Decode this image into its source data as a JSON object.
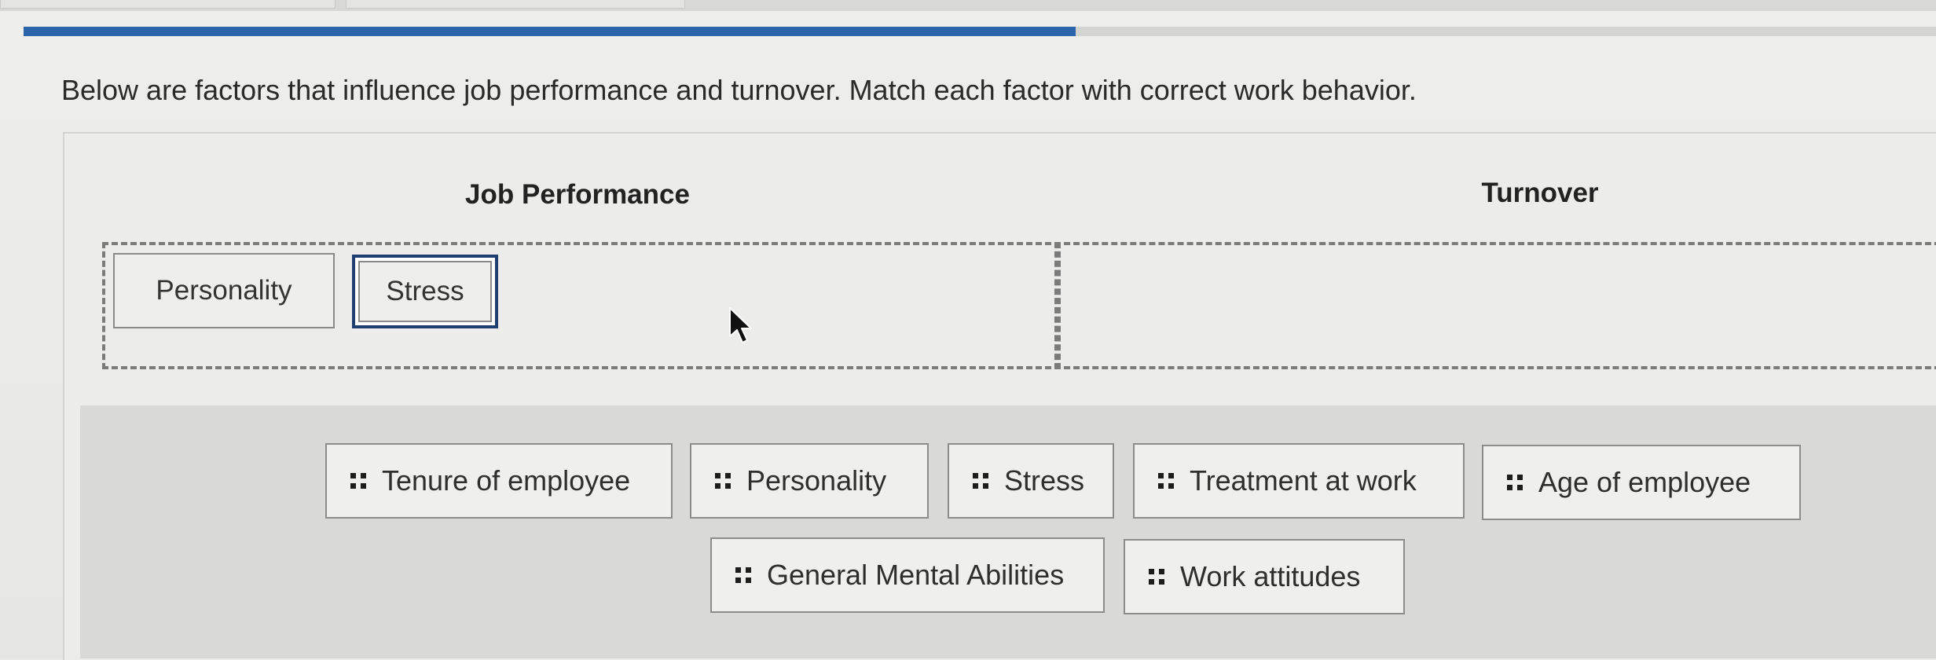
{
  "question": {
    "text": "Below are factors that influence job performance and turnover. Match each factor with correct work behavior."
  },
  "progress": {
    "fraction": 0.55,
    "color": "#2c64a8"
  },
  "columns": [
    {
      "header": "Job Performance",
      "items": [
        {
          "label": "Personality",
          "selected": false
        },
        {
          "label": "Stress",
          "selected": true
        }
      ]
    },
    {
      "header": "Turnover",
      "items": []
    }
  ],
  "bank": {
    "rows": [
      [
        {
          "label": "Tenure of employee",
          "icon": "drag-handle-icon"
        },
        {
          "label": "Personality",
          "icon": "drag-handle-icon"
        },
        {
          "label": "Stress",
          "icon": "drag-handle-icon"
        },
        {
          "label": "Treatment at work",
          "icon": "drag-handle-icon"
        },
        {
          "label": "Age of employee",
          "icon": "drag-handle-icon"
        }
      ],
      [
        {
          "label": "General Mental Abilities",
          "icon": "drag-handle-icon"
        },
        {
          "label": "Work attitudes",
          "icon": "drag-handle-icon"
        }
      ]
    ]
  },
  "cursor": {
    "icon": "mouse-pointer-icon"
  }
}
